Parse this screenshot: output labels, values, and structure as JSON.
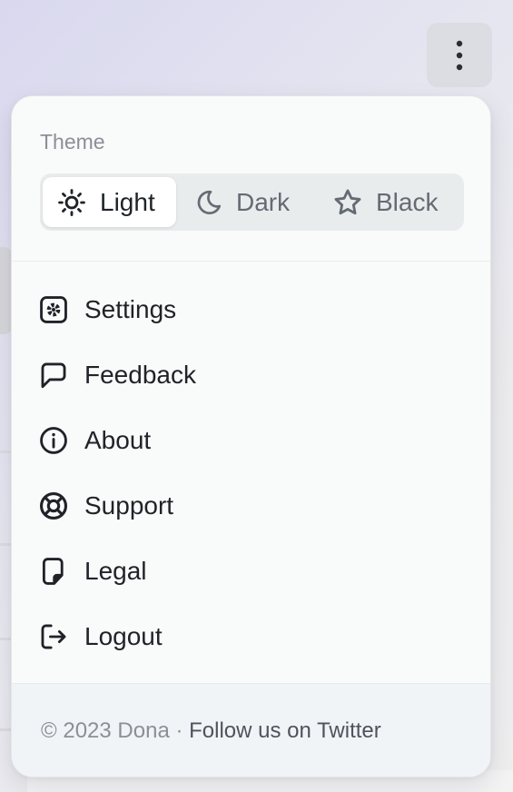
{
  "menu": {
    "theme_label": "Theme",
    "theme_options": [
      {
        "label": "Light",
        "icon": "sun-icon",
        "selected": true
      },
      {
        "label": "Dark",
        "icon": "moon-icon",
        "selected": false
      },
      {
        "label": "Black",
        "icon": "star-icon",
        "selected": false
      }
    ],
    "items": [
      {
        "label": "Settings",
        "icon": "gear-icon"
      },
      {
        "label": "Feedback",
        "icon": "chat-bubble-icon"
      },
      {
        "label": "About",
        "icon": "info-icon"
      },
      {
        "label": "Support",
        "icon": "lifebuoy-icon"
      },
      {
        "label": "Legal",
        "icon": "document-icon"
      },
      {
        "label": "Logout",
        "icon": "logout-icon"
      }
    ],
    "footer": {
      "copyright": "© 2023 Dona",
      "separator": " · ",
      "link": "Follow us on Twitter"
    }
  },
  "header": {
    "menu_button_icon": "more-vertical-icon"
  },
  "colors": {
    "text": "#1f2328",
    "muted": "#8b9097",
    "segment_bg": "#e9eced",
    "menu_bg": "#f9fafa",
    "footer_bg": "#f1f4f7"
  }
}
